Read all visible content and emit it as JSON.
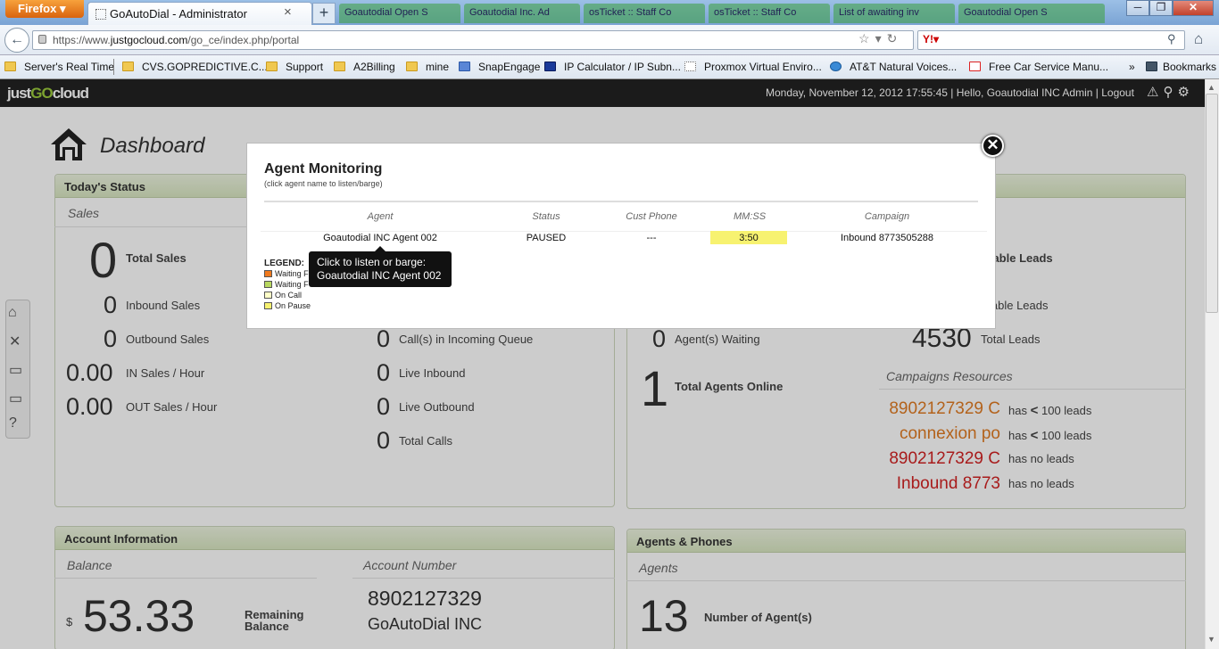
{
  "browser": {
    "menu_label": "Firefox",
    "tab_title": "GoAutoDial - Administrator",
    "tab_close": "×",
    "new_tab": "+",
    "ghost_tabs": [
      "Goautodial Open S",
      "Goautodial Inc. Ad",
      "osTicket :: Staff Co",
      "osTicket :: Staff Co",
      "List of awaiting inv",
      "Goautodial Open S"
    ],
    "url_prefix": "https://www.",
    "url_domain": "justgocloud.com",
    "url_path": "/go_ce/index.php/portal",
    "window_buttons": {
      "minimize": "─",
      "maximize": "❐",
      "close": "✕"
    }
  },
  "bookmarks": [
    {
      "label": "Server's Real Time",
      "icon": "folder"
    },
    {
      "label": "CVS.GOPREDICTIVE.C...",
      "icon": "folder"
    },
    {
      "label": "Support",
      "icon": "folder"
    },
    {
      "label": "A2Billing",
      "icon": "folder"
    },
    {
      "label": "mine",
      "icon": "folder"
    },
    {
      "label": "SnapEngage",
      "icon": "chat"
    },
    {
      "label": "IP Calculator / IP Subn...",
      "icon": "ip"
    },
    {
      "label": "Proxmox Virtual Enviro...",
      "icon": "page"
    },
    {
      "label": "AT&T Natural Voices...",
      "icon": "att"
    },
    {
      "label": "Free Car Service Manu...",
      "icon": "book"
    }
  ],
  "bookmarks_menu": "Bookmarks",
  "app": {
    "logo_a": "just",
    "logo_b": "GO",
    "logo_c": "cloud",
    "header_text": "Monday, November 12, 2012 17:55:45 | Hello, Goautodial INC Admin | Logout"
  },
  "dashboard": {
    "title": "Dashboard",
    "todays_status": "Today's Status",
    "sales_label": "Sales",
    "total_sales": {
      "value": "0",
      "label": "Total Sales"
    },
    "inbound_sales": {
      "value": "0",
      "label": "Inbound Sales"
    },
    "outbound_sales": {
      "value": "0",
      "label": "Outbound Sales"
    },
    "in_sales_hour": {
      "value": "0.00",
      "label": "IN Sales / Hour"
    },
    "out_sales_hour": {
      "value": "0.00",
      "label": "OUT Sales / Hour"
    },
    "calls_queue": {
      "value": "0",
      "label": "Call(s) in Incoming Queue"
    },
    "live_inbound": {
      "value": "0",
      "label": "Live Inbound"
    },
    "live_outbound": {
      "value": "0",
      "label": "Live Outbound"
    },
    "total_calls": {
      "value": "0",
      "label": "Total Calls"
    },
    "available_leads_1": "ailable Leads",
    "available_leads_2": "lable Leads",
    "agents_waiting": {
      "value": "0",
      "label": "Agent(s) Waiting"
    },
    "total_leads": {
      "value": "4530",
      "label": "Total Leads"
    },
    "agents_online": {
      "value": "1",
      "label": "Total Agents Online"
    },
    "campaigns_resources": "Campaigns Resources",
    "campaigns": [
      {
        "name": "8902127329 C",
        "status_pre": "has",
        "symbol": "<",
        "status": "100 leads",
        "color": "#e07b22"
      },
      {
        "name": "connexion po",
        "status_pre": "has",
        "symbol": "<",
        "status": "100 leads",
        "color": "#e07b22"
      },
      {
        "name": "8902127329 C",
        "status_pre": "has no leads",
        "symbol": "",
        "status": "",
        "color": "#d22222"
      },
      {
        "name": "Inbound 8773",
        "status_pre": "has no leads",
        "symbol": "",
        "status": "",
        "color": "#d22222"
      }
    ],
    "account_information": "Account Information",
    "balance_label": "Balance",
    "currency": "$",
    "balance_value": "53.33",
    "remaining_balance": "Remaining Balance",
    "account_number_label": "Account Number",
    "account_number": "8902127329",
    "account_name": "GoAutoDial INC",
    "agents_phones": "Agents & Phones",
    "agents_label": "Agents",
    "num_agents": {
      "value": "13",
      "label": "Number of Agent(s)"
    }
  },
  "modal": {
    "title": "Agent Monitoring",
    "subtitle": "(click agent name to listen/barge)",
    "close": "✕",
    "columns": [
      "Agent",
      "Status",
      "Cust Phone",
      "MM:SS",
      "Campaign"
    ],
    "rows": [
      {
        "agent": "Goautodial INC Agent 002",
        "status": "PAUSED",
        "cust_phone": "---",
        "mmss": "3:50",
        "campaign": "Inbound 8773505288"
      }
    ],
    "legend_title": "LEGEND:",
    "legend": [
      {
        "label": "Waiting F",
        "color": "#f07a1e"
      },
      {
        "label": "Waiting F",
        "color": "#b8d860"
      },
      {
        "label": "On Call",
        "color": "#ffffc8"
      },
      {
        "label": "On Pause",
        "color": "#f7f270"
      }
    ],
    "tooltip_line1": "Click to listen or barge:",
    "tooltip_line2": "Goautodial INC Agent 002"
  }
}
